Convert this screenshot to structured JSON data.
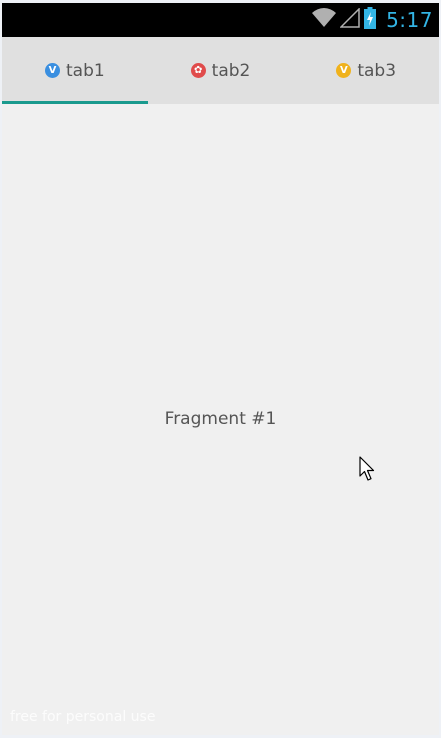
{
  "status_bar": {
    "time": "5:17",
    "icons": [
      "wifi-icon",
      "signal-icon",
      "battery-charging-icon"
    ],
    "time_color": "#33b5e5"
  },
  "tabs": [
    {
      "label": "tab1",
      "icon": "tab1-icon",
      "icon_glyph": "V",
      "icon_color": "#3a8fe0",
      "selected": true
    },
    {
      "label": "tab2",
      "icon": "tab2-icon",
      "icon_glyph": "✿",
      "icon_color": "#e04b4b",
      "selected": false
    },
    {
      "label": "tab3",
      "icon": "tab3-icon",
      "icon_glyph": "V",
      "icon_color": "#f0b21c",
      "selected": false
    }
  ],
  "indicator_color": "#1a9a8e",
  "content": {
    "text": "Fragment #1"
  },
  "watermark": "free for personal use"
}
